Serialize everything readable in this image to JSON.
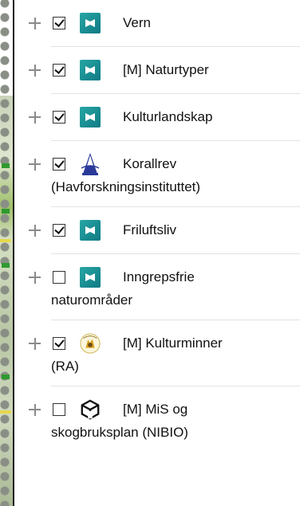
{
  "layers": [
    {
      "label": "Vern",
      "cont": "",
      "checked": true,
      "icon": "teal-map-icon"
    },
    {
      "label": "[M] Naturtyper",
      "cont": "",
      "checked": true,
      "icon": "teal-map-icon"
    },
    {
      "label": "Kulturlandskap",
      "cont": "",
      "checked": true,
      "icon": "teal-map-icon"
    },
    {
      "label": "Korallrev",
      "cont": "(Havforskningsinstituttet)",
      "checked": true,
      "icon": "lighthouse-icon"
    },
    {
      "label": "Friluftsliv",
      "cont": "",
      "checked": true,
      "icon": "teal-map-icon"
    },
    {
      "label": "Inngrepsfrie",
      "cont": "naturområder",
      "checked": false,
      "icon": "teal-map-icon"
    },
    {
      "label": "[M] Kulturminner",
      "cont": "(RA)",
      "checked": true,
      "icon": "riksantikvaren-seal-icon"
    },
    {
      "label": "[M] MiS og",
      "cont": "skogbruksplan (NIBIO)",
      "checked": false,
      "icon": "nibio-logo-icon"
    }
  ]
}
